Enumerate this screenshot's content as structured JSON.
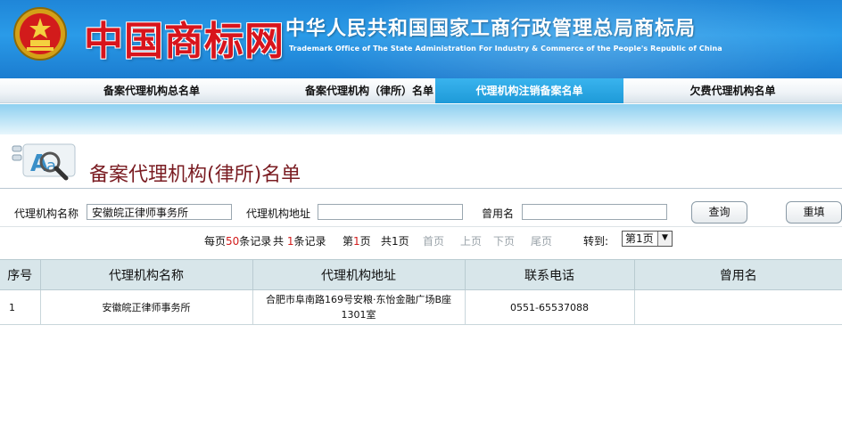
{
  "header": {
    "logo_text": "中国商标网",
    "org_name_cn": "中华人民共和国国家工商行政管理总局商标局",
    "org_name_en": "Trademark Office of The State Administration For Industry & Commerce of the People's Republic of China"
  },
  "nav": {
    "items": [
      {
        "label": "备案代理机构总名单"
      },
      {
        "label": "备案代理机构（律所）名单"
      },
      {
        "label": "代理机构注销备案名单"
      },
      {
        "label": "欠费代理机构名单"
      }
    ],
    "active_index": 2
  },
  "page": {
    "title": "备案代理机构(律所)名单"
  },
  "search": {
    "name_label": "代理机构名称",
    "name_value": "安徽皖正律师事务所",
    "address_label": "代理机构地址",
    "address_value": "",
    "former_name_label": "曾用名",
    "former_name_value": "",
    "query_button": "查询",
    "reset_button": "重填"
  },
  "pagination": {
    "per_page_prefix": "每页",
    "per_page_value": "50",
    "per_page_suffix": "条记录",
    "total_prefix": "共",
    "total_value": "1",
    "total_suffix": "条记录",
    "current_prefix": "第",
    "current_value": "1",
    "current_suffix": "页",
    "pages_prefix": "共",
    "pages_value": "1",
    "pages_suffix": "页",
    "first": "首页",
    "prev": "上页",
    "next": "下页",
    "last": "尾页",
    "goto_label": "转到:",
    "goto_selected": "第1页"
  },
  "table": {
    "columns": [
      "序号",
      "代理机构名称",
      "代理机构地址",
      "联系电话",
      "曾用名"
    ],
    "rows": [
      {
        "index": "1",
        "name": "安徽皖正律师事务所",
        "address": "合肥市阜南路169号安粮·东怡金融广场B座1301室",
        "phone": "0551-65537088",
        "former_name": ""
      }
    ]
  },
  "colors": {
    "banner_blue": "#1f86d8",
    "nav_active": "#1e9ad8",
    "title_red": "#7a1c22",
    "page_number_red": "#d21b1b",
    "table_header_bg": "#d8e6ea"
  }
}
